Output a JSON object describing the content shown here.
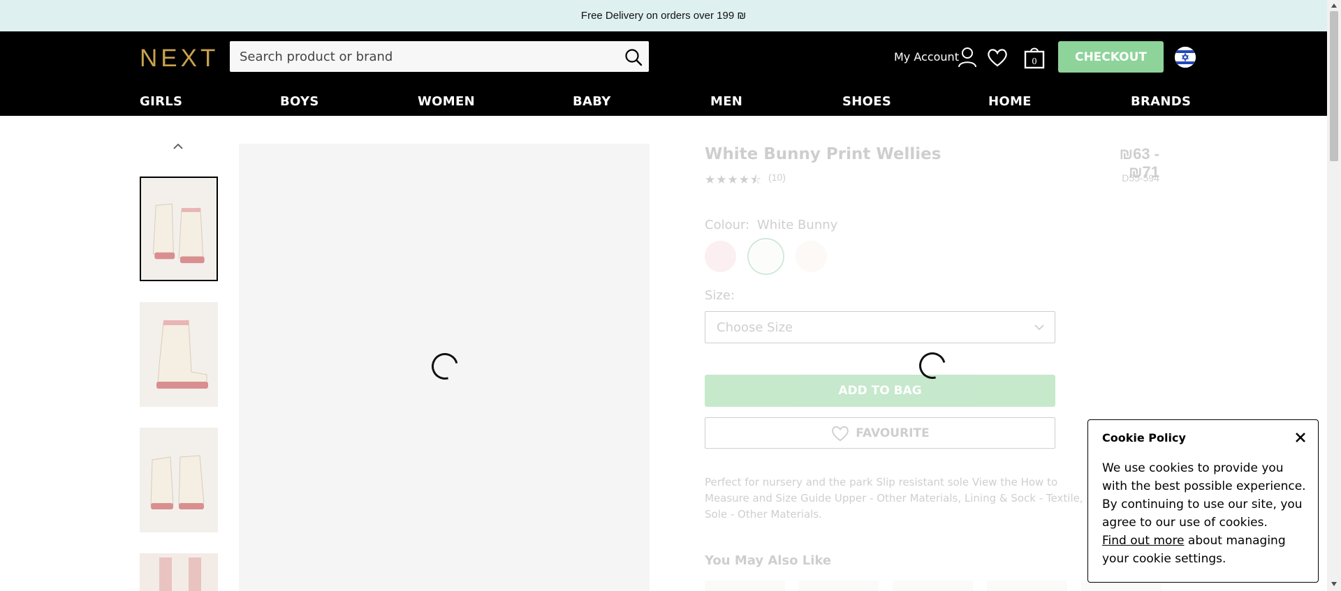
{
  "banner": {
    "text": "Free Delivery on orders over 199 ₪"
  },
  "header": {
    "logo": "NEXT",
    "search_placeholder": "Search product or brand",
    "account_label": "My Account",
    "bag_count": "0",
    "checkout_label": "CHECKOUT"
  },
  "nav": {
    "items": [
      {
        "label": "GIRLS"
      },
      {
        "label": "BOYS"
      },
      {
        "label": "WOMEN"
      },
      {
        "label": "BABY"
      },
      {
        "label": "MEN"
      },
      {
        "label": "SHOES"
      },
      {
        "label": "HOME"
      },
      {
        "label": "BRANDS"
      }
    ]
  },
  "product": {
    "title": "White Bunny Print Wellies",
    "price": "₪63 - ₪71",
    "stars": "★★★★⯪",
    "rating_value": 4.5,
    "review_count": "(10)",
    "code": "D55-594",
    "colour_label": "Colour:",
    "colour_value": "White Bunny",
    "size_label": "Size:",
    "size_placeholder": "Choose Size",
    "add_to_bag_label": "ADD TO BAG",
    "favourite_label": "FAVOURITE",
    "description": "Perfect for nursery and the park Slip resistant sole View the How to Measure and Size Guide Upper - Other Materials, Lining & Sock - Textile, Sole - Other Materials.",
    "also_like_title": "You May Also Like"
  },
  "colors": {
    "accent_green": "#8ed39a",
    "logo_gold": "#c9a24e",
    "banner_bg": "#def0ef"
  },
  "cookie": {
    "title": "Cookie Policy",
    "body": "We use cookies to provide you with the best possible experience. By continuing to use our site, you agree to our use of cookies.",
    "link_text": "Find out more",
    "tail_text": " about managing your cookie settings."
  }
}
